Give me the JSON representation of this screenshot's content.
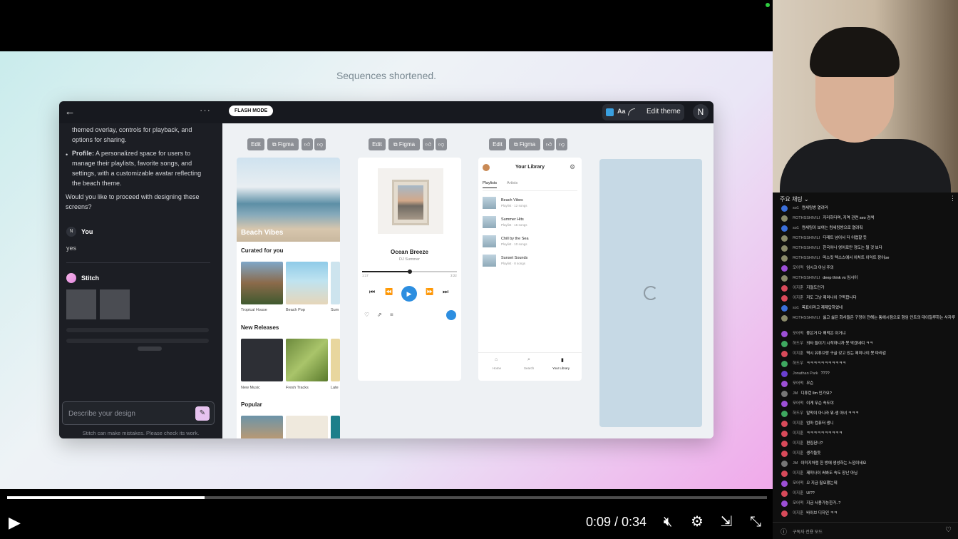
{
  "slide": {
    "caption": "Sequences shortened."
  },
  "app": {
    "mode_badge": "FLASH MODE",
    "theme_aa": "Aa",
    "edit_theme": "Edit theme",
    "user_initial": "N",
    "chat": {
      "lines": [
        "themed overlay, controls for playback, and",
        "options for sharing.",
        "Profile: A personalized space for users to",
        "manage their playlists, favorite songs, and",
        "settings, with a customizable avatar reflecting",
        "the beach theme.",
        "Would you like to proceed with designing these",
        "screens?"
      ],
      "user_initial": "N",
      "user_name": "You",
      "user_reply": "yes",
      "assistant_name": "Stitch",
      "prompt_placeholder": "Describe your design",
      "disclaimer": "Stitch can make mistakes. Please check its work."
    },
    "toolbar": {
      "edit": "Edit",
      "figma": "Figma",
      "like_icon": "thumbs-up-icon",
      "dislike_icon": "thumbs-down-icon"
    },
    "screen1": {
      "hero_title": "Beach Vibes",
      "curated": "Curated for you",
      "curated_items": [
        "Tropical House",
        "Beach Pop",
        "Sum"
      ],
      "new_releases": "New Releases",
      "new_items": [
        "New Music",
        "Fresh Tracks",
        "Late"
      ],
      "popular": "Popular"
    },
    "screen2": {
      "title": "Ocean Breeze",
      "artist": "DJ Summer",
      "progress": 0.5,
      "time_start": "1:17",
      "time_end": "3:22"
    },
    "screen3": {
      "title": "Your Library",
      "tabs": [
        "Playlists",
        "Artists"
      ],
      "items": [
        {
          "name": "Beach Vibes",
          "sub": "Playlist · 12 songs"
        },
        {
          "name": "Summer Hits",
          "sub": "Playlist · 15 songs"
        },
        {
          "name": "Chill by the Sea",
          "sub": "Playlist · 10 songs"
        },
        {
          "name": "Sunset Sounds",
          "sub": "Playlist · 8 songs"
        }
      ],
      "nav": [
        "Home",
        "Search",
        "Your Library"
      ]
    }
  },
  "player": {
    "time": "0:09 / 0:34",
    "progress": 0.26
  },
  "chat": {
    "header": "주요 채팅",
    "footer": "구독자 전용 모드",
    "messages": [
      {
        "name": "so1",
        "text": "컴세팅방 열려라",
        "color": "#3b6fd8"
      },
      {
        "name": "ROTHSSHIVILI",
        "text": "지리하다며, 지역 관련 seo 검색",
        "color": "#8a8a6a"
      },
      {
        "name": "so1",
        "text": "컴세팅이 보여는 컴세팅방으로 열려줘",
        "color": "#3b6fd8"
      },
      {
        "name": "ROTHSSHIVILI",
        "text": "디레트 넘어서 더 어렵할 듯",
        "color": "#8a8a6a"
      },
      {
        "name": "ROTHSSHIVILI",
        "text": "한국어나 영어로만 정도는 될 것 보다",
        "color": "#8a8a6a"
      },
      {
        "name": "ROTHSSHIVILI",
        "text": "머스킷 텍스스에서 이치트 이익트 장이oe",
        "color": "#8a8a6a"
      },
      {
        "name": "모어떡",
        "text": "임시크 아님 주의",
        "color": "#9c4fd6"
      },
      {
        "name": "ROTHSSHIVILI",
        "text": "deep think vs 임시이",
        "color": "#8a8a6a"
      },
      {
        "name": "이지훈",
        "text": "지절도인가",
        "color": "#d84a5a"
      },
      {
        "name": "이지훈",
        "text": "저도 그냥 제미나이 구독합니다",
        "color": "#d84a5a"
      },
      {
        "name": "so1",
        "text": "목표이라고 제제답하였네",
        "color": "#3b6fd8"
      },
      {
        "name": "ROTHSSHIVILI",
        "text": "싫고 싫은 회사들은 구정이 전해는 통에시점으로 형임 인트의 대이칠루하는 사자루",
        "color": "#8a8a6a"
      },
      {
        "name": "모어떡",
        "text": "좋은거 다 해먹은 이거냐",
        "color": "#9c4fd6"
      },
      {
        "name": "하드우",
        "text": "의타 들이기 시작하니까 못 막겠네여 ㅋㅋ",
        "color": "#3ea860"
      },
      {
        "name": "이지훈",
        "text": "역시 유튜브랑 구글 갖고 있는 제미나이 못 따라감",
        "color": "#d84a5a"
      },
      {
        "name": "하드우",
        "text": "ㅋㅋㅋㅋㅋㅋㅋㅋㅋㅋㅋ",
        "color": "#3ea860"
      },
      {
        "name": "Jonathan Park",
        "text": "????",
        "color": "#6a3fd0"
      },
      {
        "name": "모어떡",
        "text": "무슨",
        "color": "#9c4fd6"
      },
      {
        "name": "JM",
        "text": "디휴런 llm 인가요?",
        "color": "#777777"
      },
      {
        "name": "모어떡",
        "text": "이게 무슨 속도야",
        "color": "#9c4fd6"
      },
      {
        "name": "하드우",
        "text": "말막이 아니라 뭐-생 아녀 ㅋㅋㅋ",
        "color": "#3ea860"
      },
      {
        "name": "이지훈",
        "text": "엄마 컴퓨터 생니",
        "color": "#d84a5a"
      },
      {
        "name": "이지훈",
        "text": "ㅋㅋㅋㅋㅋㅋㅋㅋㅋㅋ",
        "color": "#d84a5a"
      },
      {
        "name": "이지훈",
        "text": "편집된나?",
        "color": "#d84a5a"
      },
      {
        "name": "이지훈",
        "text": "생각들듯",
        "color": "#d84a5a"
      },
      {
        "name": "JM",
        "text": "이미지처럼 한 방에 생성하는 느낌이네요",
        "color": "#777777"
      },
      {
        "name": "이지훈",
        "text": "제미나이 써봐도 속도 장난 아님",
        "color": "#d84a5a"
      },
      {
        "name": "모어떡",
        "text": "오 지금 필요했는데",
        "color": "#9c4fd6"
      },
      {
        "name": "이지훈",
        "text": "UI??",
        "color": "#d84a5a"
      },
      {
        "name": "모어떡",
        "text": "지금 사용가능한가..?",
        "color": "#9c4fd6"
      },
      {
        "name": "이지훈",
        "text": "바이브 디자인 ㅋㅋ",
        "color": "#d84a5a"
      }
    ]
  },
  "colors": {
    "accent": "#2d8ee0",
    "stitch": "#e38be0"
  }
}
